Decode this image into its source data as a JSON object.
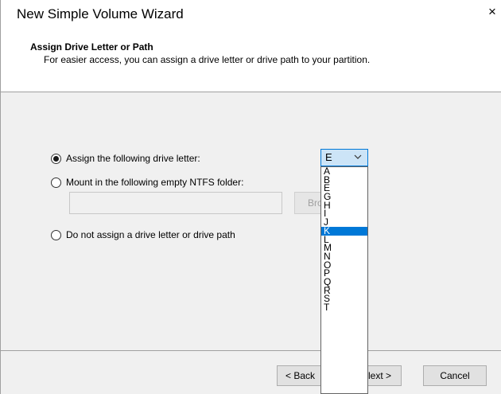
{
  "window": {
    "title": "New Simple Volume Wizard",
    "close_glyph": "×"
  },
  "header": {
    "title": "Assign Drive Letter or Path",
    "subtitle": "For easier access, you can assign a drive letter or drive path to your partition."
  },
  "options": {
    "assign_letter": {
      "label": "Assign the following drive letter:",
      "checked": true
    },
    "mount_folder": {
      "label": "Mount in the following empty NTFS folder:",
      "checked": false
    },
    "no_assign": {
      "label": "Do not assign a drive letter or drive path",
      "checked": false
    }
  },
  "folder_input": {
    "value": ""
  },
  "browse_button": {
    "label": "Bro"
  },
  "drive_select": {
    "selected": "E",
    "options": [
      "A",
      "B",
      "E",
      "G",
      "H",
      "I",
      "J",
      "K",
      "L",
      "M",
      "N",
      "O",
      "P",
      "Q",
      "R",
      "S",
      "T"
    ],
    "highlighted": "K"
  },
  "footer": {
    "back_label": "< Back",
    "next_label": "lext >",
    "cancel_label": "Cancel"
  },
  "colors": {
    "accent": "#0078d7",
    "select_bg": "#cce4f7"
  }
}
